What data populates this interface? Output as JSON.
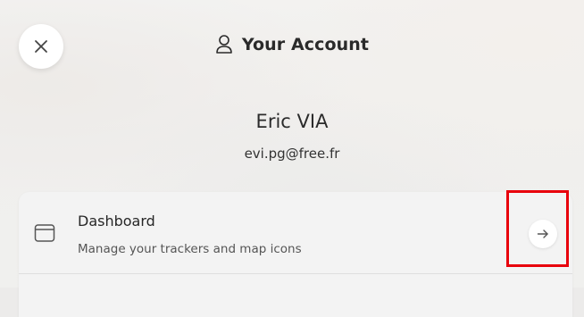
{
  "header": {
    "title": "Your Account",
    "title_icon": "user-icon",
    "close_icon": "close-icon"
  },
  "profile": {
    "name": "Eric VIA",
    "email": "evi.pg@free.fr"
  },
  "menu": {
    "items": [
      {
        "icon": "window-icon",
        "title": "Dashboard",
        "subtitle": "Manage your trackers and map icons",
        "action_icon": "arrow-right-icon"
      }
    ]
  },
  "colors": {
    "highlight": "#e8000c",
    "card_background": "#f3f3f3",
    "text_primary": "#262626"
  }
}
